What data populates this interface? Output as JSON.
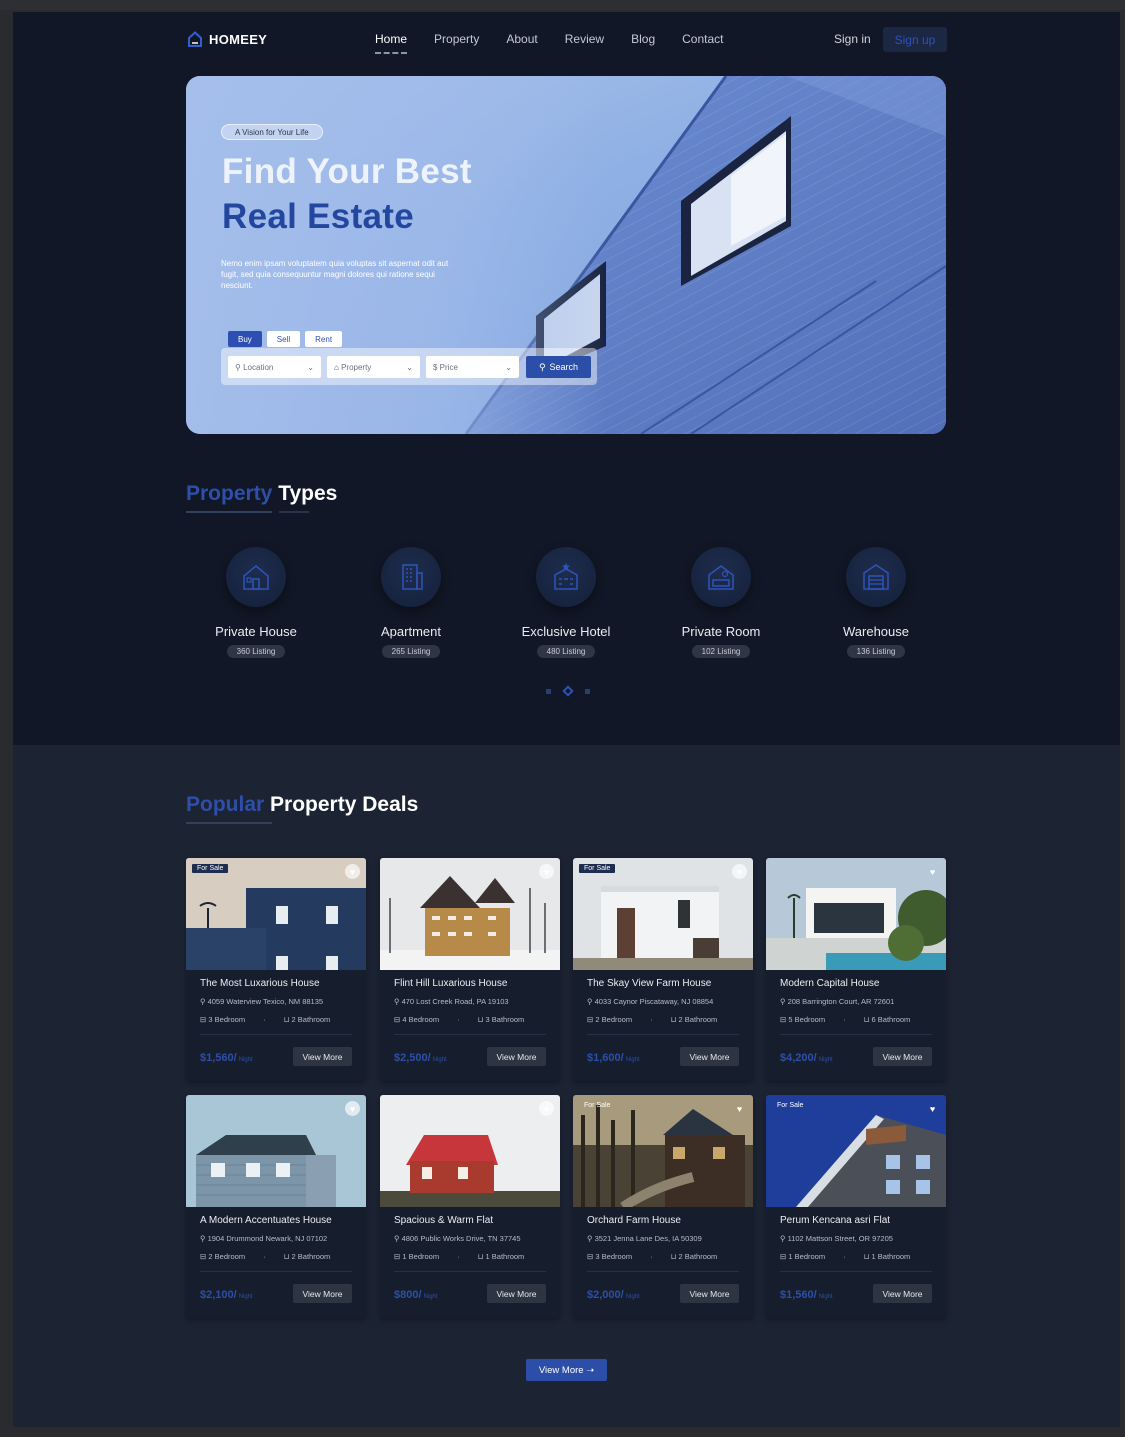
{
  "brand": {
    "name": "HOMEEY"
  },
  "nav": {
    "items": [
      "Home",
      "Property",
      "About",
      "Review",
      "Blog",
      "Contact"
    ],
    "active": "Home"
  },
  "auth": {
    "signin": "Sign in",
    "signup": "Sign up"
  },
  "hero": {
    "tag": "A Vision for Your Life",
    "title_line1": "Find Your Best",
    "title_line2": "Real Estate",
    "description": "Nemo enim ipsam voluptatem quia voluptas sit aspernat odit aut fugit, sed quia consequuntur magni dolores qui ratione sequi nesciunt.",
    "tabs": [
      "Buy",
      "Sell",
      "Rent"
    ],
    "active_tab": "Buy",
    "filters": {
      "location": "Location",
      "property": "Property",
      "price": "Price"
    },
    "search_label": "Search"
  },
  "types_section": {
    "title_blue": "Property",
    "title_white": "Types",
    "items": [
      {
        "name": "Private House",
        "count": "360 Listing",
        "icon": "house-icon"
      },
      {
        "name": "Apartment",
        "count": "265 Listing",
        "icon": "apartment-icon"
      },
      {
        "name": "Exclusive Hotel",
        "count": "480 Listing",
        "icon": "hotel-icon"
      },
      {
        "name": "Private Room",
        "count": "102 Listing",
        "icon": "room-icon"
      },
      {
        "name": "Warehouse",
        "count": "136 Listing",
        "icon": "warehouse-icon"
      }
    ]
  },
  "deals_section": {
    "title_blue": "Popular",
    "title_white": "Property Deals",
    "cards": [
      {
        "title": "The Most Luxarious House",
        "address": "4059 Waterview Texico, NM 88135",
        "bedrooms": "3 Bedroom",
        "bathrooms": "2 Bathroom",
        "price": "$1,560/",
        "unit": "Night",
        "badge": "For Sale",
        "button": "View More",
        "favorite": false
      },
      {
        "title": "Flint Hill Luxarious House",
        "address": "470 Lost Creek Road, PA 19103",
        "bedrooms": "4 Bedroom",
        "bathrooms": "3 Bathroom",
        "price": "$2,500/",
        "unit": "Night",
        "badge": "",
        "button": "View More",
        "favorite": false
      },
      {
        "title": "The Skay View Farm House",
        "address": "4033 Caynor Piscataway, NJ 08854",
        "bedrooms": "2 Bedroom",
        "bathrooms": "2 Bathroom",
        "price": "$1,600/",
        "unit": "Night",
        "badge": "For Sale",
        "button": "View More",
        "favorite": false
      },
      {
        "title": "Modern Capital House",
        "address": "208 Barrington Court, AR 72601",
        "bedrooms": "5 Bedroom",
        "bathrooms": "6 Bathroom",
        "price": "$4,200/",
        "unit": "Night",
        "badge": "",
        "button": "View More",
        "favorite": true
      },
      {
        "title": "A Modern Accentuates House",
        "address": "1904 Drummond Newark, NJ 07102",
        "bedrooms": "2 Bedroom",
        "bathrooms": "2 Bathroom",
        "price": "$2,100/",
        "unit": "Night",
        "badge": "",
        "button": "View More",
        "favorite": false
      },
      {
        "title": "Spacious & Warm Flat",
        "address": "4806 Public Works Drive, TN 37745",
        "bedrooms": "1 Bedroom",
        "bathrooms": "1 Bathroom",
        "price": "$800/",
        "unit": "Night",
        "badge": "",
        "button": "View More",
        "favorite": false
      },
      {
        "title": "Orchard Farm House",
        "address": "3521 Jenna Lane Des, IA 50309",
        "bedrooms": "3 Bedroom",
        "bathrooms": "2 Bathroom",
        "price": "$2,000/",
        "unit": "Night",
        "badge": "For Sale",
        "button": "View More",
        "favorite": true
      },
      {
        "title": "Perum Kencana asri Flat",
        "address": "1102 Mattson Street, OR 97205",
        "bedrooms": "1 Bedroom",
        "bathrooms": "1 Bathroom",
        "price": "$1,560/",
        "unit": "Night",
        "badge": "For Sale",
        "button": "View More",
        "favorite": true
      }
    ],
    "view_more": "View More"
  },
  "colors": {
    "accent": "#2e4fa9",
    "background": "#111726",
    "section_background": "#1c2333"
  }
}
